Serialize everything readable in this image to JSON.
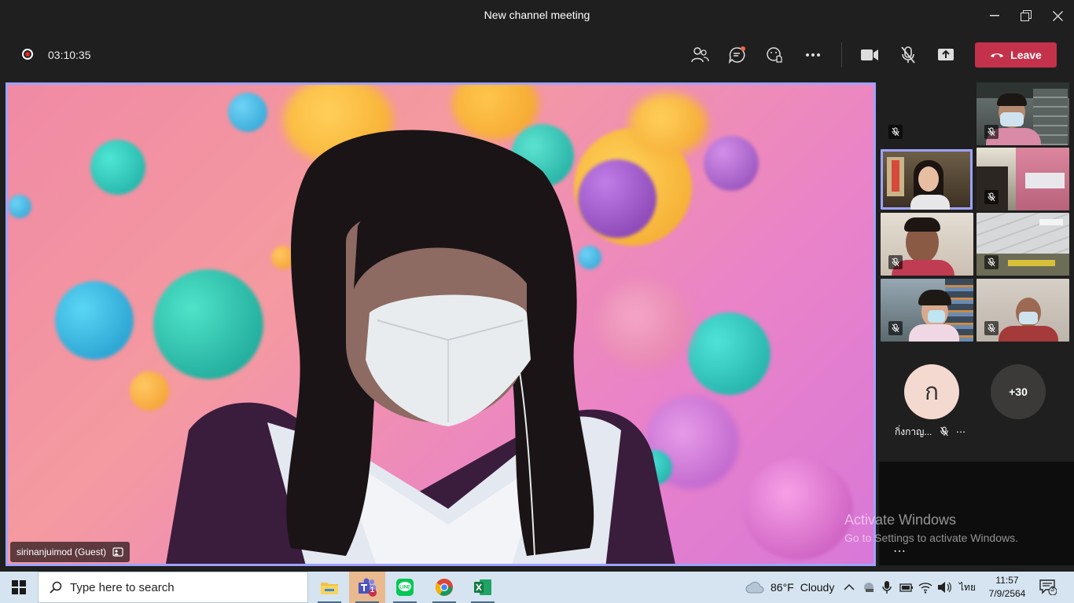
{
  "window": {
    "title": "New channel meeting"
  },
  "toolbar": {
    "timer": "03:10:35",
    "leave_label": "Leave"
  },
  "stage": {
    "participant_name": "sirinanjuimod (Guest)"
  },
  "roster": {
    "avatar_initial": "ก",
    "avatar_name": "กิ่งกาญ...",
    "overflow_count": "+30",
    "more_dots": "⋯"
  },
  "watermark": {
    "line1": "Activate Windows",
    "line2": "Go to Settings to activate Windows."
  },
  "taskbar": {
    "search_placeholder": "Type here to search",
    "weather_temp": "86°F",
    "weather_text": "Cloudy",
    "language": "ไทย",
    "time": "11:57",
    "date": "7/9/2564",
    "notification_count": "3",
    "teams_badge": "1"
  },
  "colors": {
    "accent": "#9ea2ff",
    "leave": "#c4314b",
    "record": "#d92c2c"
  }
}
